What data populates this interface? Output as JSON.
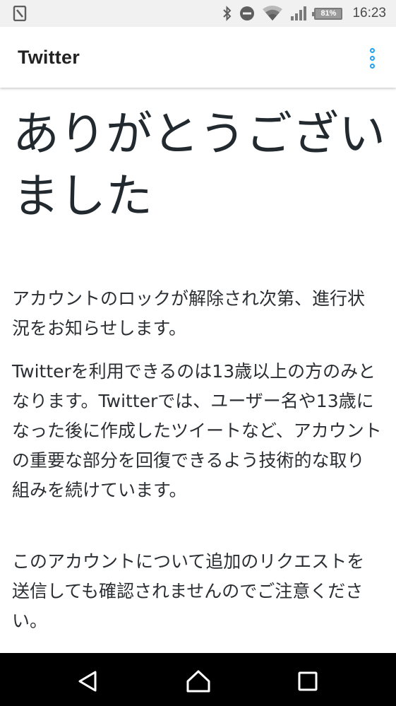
{
  "status_bar": {
    "battery_percent": "81%",
    "time": "16:23",
    "icons": [
      "notification-icon",
      "bluetooth-icon",
      "do-not-disturb-icon",
      "wifi-icon",
      "signal-icon",
      "battery-icon"
    ]
  },
  "app_bar": {
    "title": "Twitter",
    "menu_icon": "overflow-menu-icon",
    "accent_color": "#1da1f2"
  },
  "content": {
    "heading": "ありがとうございました",
    "paragraphs": [
      "アカウントのロックが解除され次第、進行状況をお知らせします。",
      "Twitterを利用できるのは13歳以上の方のみとなります。Twitterでは、ユーザー名や13歳になった後に作成したツイートなど、アカウントの重要な部分を回復できるよう技術的な取り組みを続けています。",
      "このアカウントについて追加のリクエストを送信しても確認されませんのでご注意ください。"
    ]
  },
  "nav_bar": {
    "buttons": [
      "back-icon",
      "home-icon",
      "recents-icon"
    ]
  }
}
